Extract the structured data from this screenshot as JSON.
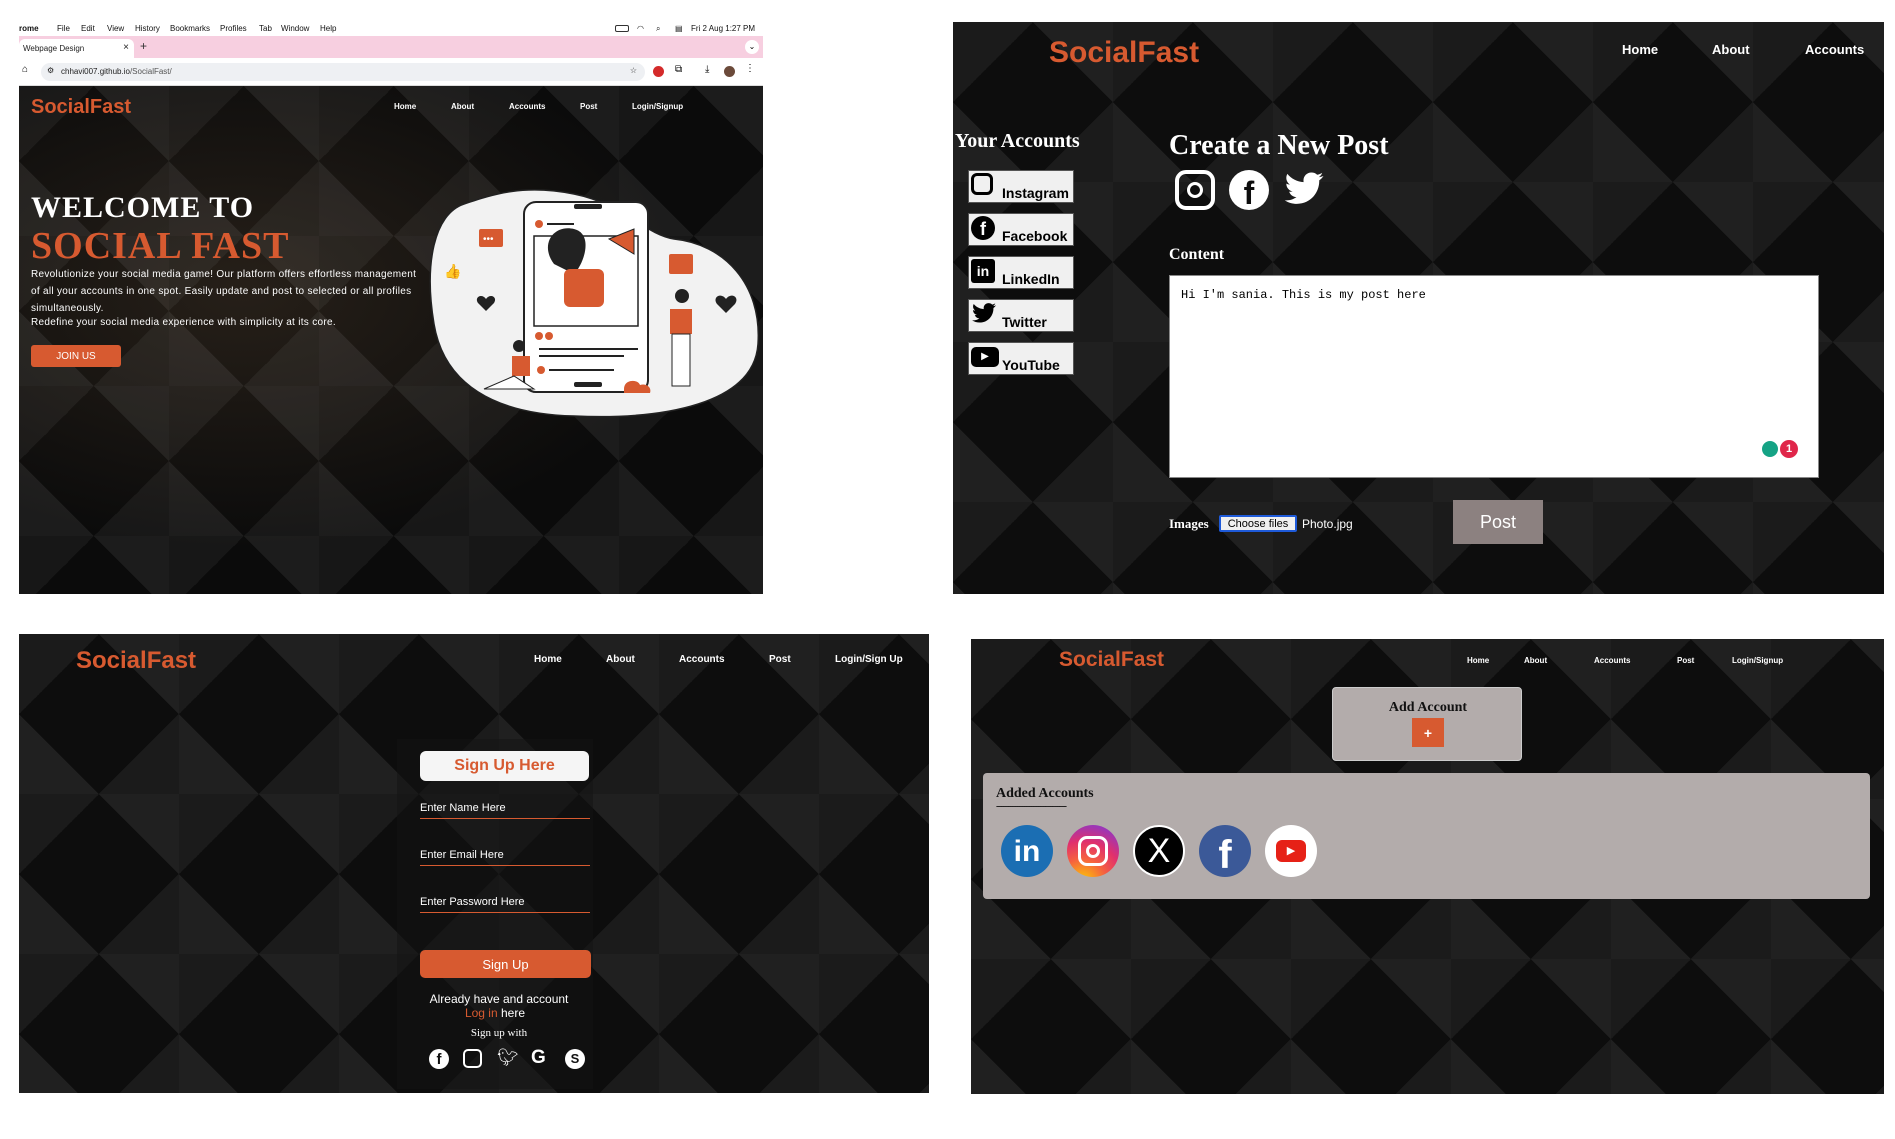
{
  "browser": {
    "app_name": "rome",
    "menu": [
      "File",
      "Edit",
      "View",
      "History",
      "Bookmarks",
      "Profiles",
      "Tab",
      "Window",
      "Help"
    ],
    "clock": "Fri 2 Aug  1:27 PM",
    "tab_title": "Webpage Design",
    "tab_close": "×",
    "new_tab": "+",
    "url_host": "chhavi007.github.io",
    "url_path": "/SocialFast/"
  },
  "home": {
    "brand": "SocialFast",
    "nav": [
      "Home",
      "About",
      "Accounts",
      "Post",
      "Login/Signup"
    ],
    "headline_1": "WELCOME TO",
    "headline_2": "SOCIAL FAST",
    "description_1": "Revolutionize your social media game! Our platform offers effortless management of all your accounts in one spot. Easily update and post to selected or all profiles simultaneously.",
    "description_2": "Redefine your social media experience with simplicity at its core.",
    "cta": "JOIN US"
  },
  "post": {
    "brand": "SocialFast",
    "nav": [
      "Home",
      "About",
      "Accounts"
    ],
    "accounts_title": "Your Accounts",
    "accounts": [
      "Instagram",
      "Facebook",
      "LinkedIn",
      "Twitter",
      "YouTube"
    ],
    "title": "Create a New Post",
    "content_label": "Content",
    "content_value": "Hi I'm sania. This is my post here",
    "grammar_badge": "1",
    "images_label": "Images",
    "choose_files": "Choose files",
    "file_name": "Photo.jpg",
    "post_button": "Post"
  },
  "signup": {
    "brand": "SocialFast",
    "nav": [
      "Home",
      "About",
      "Accounts",
      "Post",
      "Login/Sign Up"
    ],
    "title": "Sign Up Here",
    "name_placeholder": "Enter Name Here",
    "email_placeholder": "Enter Email Here",
    "password_placeholder": "Enter Password Here",
    "submit": "Sign Up",
    "already": "Already have and account",
    "login_link": "Log in",
    "here": "here",
    "signup_with": "Sign up with"
  },
  "accounts": {
    "brand": "SocialFast",
    "nav": [
      "Home",
      "About",
      "Accounts",
      "Post",
      "Login/Signup"
    ],
    "add_title": "Add Account",
    "add_button": "+",
    "added_title": "Added Accounts",
    "divider": "------------------------------",
    "icons": [
      "linkedin-icon",
      "instagram-icon",
      "x-icon",
      "facebook-icon",
      "youtube-icon"
    ]
  },
  "colors": {
    "accent": "#d75a30",
    "dark": "#0b0b0b"
  }
}
